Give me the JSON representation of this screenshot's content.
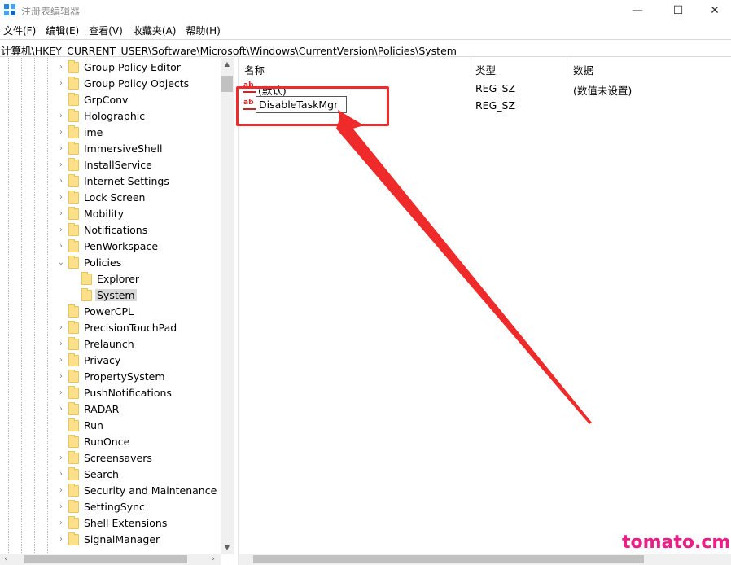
{
  "window": {
    "title": "注册表编辑器"
  },
  "menu": [
    "文件(F)",
    "编辑(E)",
    "查看(V)",
    "收藏夹(A)",
    "帮助(H)"
  ],
  "address": "计算机\\HKEY_CURRENT_USER\\Software\\Microsoft\\Windows\\CurrentVersion\\Policies\\System",
  "tree": [
    {
      "label": "Group Policy Editor",
      "expander": "›"
    },
    {
      "label": "Group Policy Objects",
      "expander": "›"
    },
    {
      "label": "GrpConv",
      "expander": ""
    },
    {
      "label": "Holographic",
      "expander": "›"
    },
    {
      "label": "ime",
      "expander": "›"
    },
    {
      "label": "ImmersiveShell",
      "expander": "›"
    },
    {
      "label": "InstallService",
      "expander": "›"
    },
    {
      "label": "Internet Settings",
      "expander": "›"
    },
    {
      "label": "Lock Screen",
      "expander": "›"
    },
    {
      "label": "Mobility",
      "expander": "›"
    },
    {
      "label": "Notifications",
      "expander": "›"
    },
    {
      "label": "PenWorkspace",
      "expander": "›"
    },
    {
      "label": "Policies",
      "expander": "⌄"
    },
    {
      "label": "Explorer",
      "expander": "",
      "child": true
    },
    {
      "label": "System",
      "expander": "",
      "child": true,
      "selected": true
    },
    {
      "label": "PowerCPL",
      "expander": ""
    },
    {
      "label": "PrecisionTouchPad",
      "expander": "›"
    },
    {
      "label": "Prelaunch",
      "expander": "›"
    },
    {
      "label": "Privacy",
      "expander": "›"
    },
    {
      "label": "PropertySystem",
      "expander": "›"
    },
    {
      "label": "PushNotifications",
      "expander": "›"
    },
    {
      "label": "RADAR",
      "expander": "›"
    },
    {
      "label": "Run",
      "expander": ""
    },
    {
      "label": "RunOnce",
      "expander": ""
    },
    {
      "label": "Screensavers",
      "expander": "›"
    },
    {
      "label": "Search",
      "expander": "›"
    },
    {
      "label": "Security and Maintenance",
      "expander": "›"
    },
    {
      "label": "SettingSync",
      "expander": "›"
    },
    {
      "label": "Shell Extensions",
      "expander": "›"
    },
    {
      "label": "SignalManager",
      "expander": "›"
    }
  ],
  "columns": {
    "name": "名称",
    "type": "类型",
    "data": "数据"
  },
  "values": [
    {
      "name": "(默认)",
      "type": "REG_SZ",
      "data": "(数值未设置)"
    },
    {
      "name": "DisableTaskMgr",
      "type": "REG_SZ",
      "data": "",
      "editing": true
    }
  ],
  "watermark": "tomato.cm",
  "colors": {
    "annotation": "#ee2a2a",
    "watermark": "#e91e86",
    "folder": "#ffe08a"
  }
}
